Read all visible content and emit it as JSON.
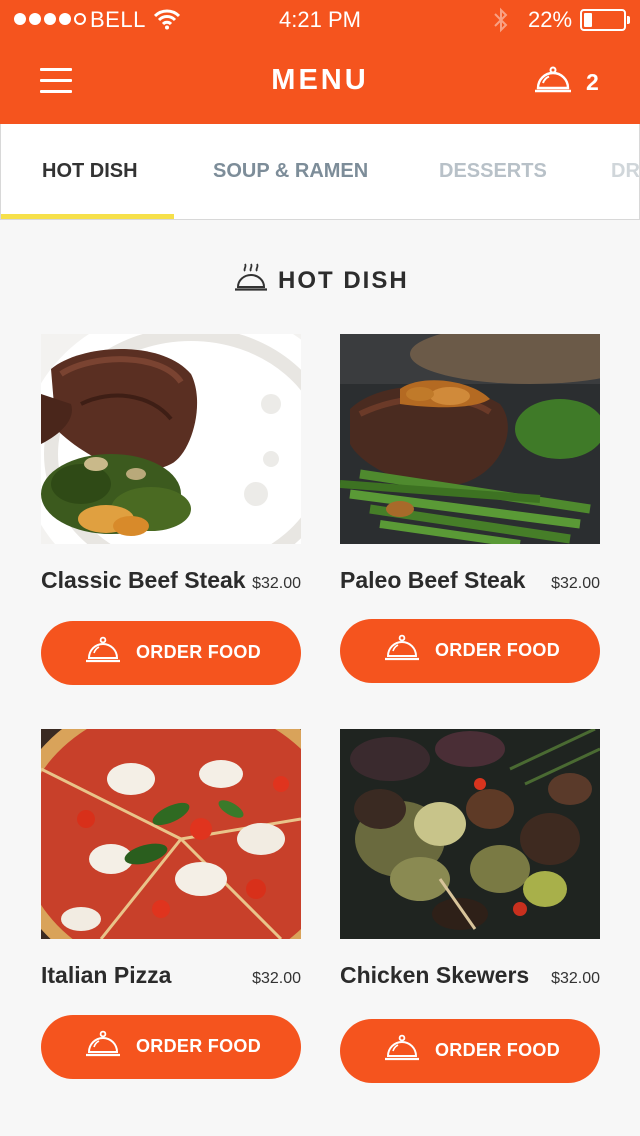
{
  "status_bar": {
    "carrier": "BELL",
    "time": "4:21 PM",
    "battery": "22%",
    "battery_level": 0.22,
    "signal_bars": 4,
    "signal_max": 5
  },
  "header": {
    "title": "MENU",
    "cart_count": "2",
    "menu_icon": "hamburger-icon",
    "cart_icon": "cloche-icon"
  },
  "tabs": [
    {
      "label": "HOT DISH",
      "active": true
    },
    {
      "label": "SOUP & RAMEN",
      "active": false
    },
    {
      "label": "DESSERTS",
      "active": false
    },
    {
      "label": "DRINKS",
      "active": false
    }
  ],
  "section": {
    "title": "HOT DISH",
    "icon": "steaming-cloche-icon"
  },
  "dishes": [
    {
      "name": "Classic Beef Steak",
      "price": "$32.00",
      "button": "ORDER FOOD"
    },
    {
      "name": "Paleo Beef Steak",
      "price": "$32.00",
      "button": "ORDER FOOD"
    },
    {
      "name": "Italian Pizza",
      "price": "$32.00",
      "button": "ORDER FOOD"
    },
    {
      "name": "Chicken Skewers",
      "price": "$32.00",
      "button": "ORDER FOOD"
    }
  ],
  "colors": {
    "accent": "#f5541e",
    "tab_underline": "#f6e04a",
    "background": "#f7f7f7"
  }
}
